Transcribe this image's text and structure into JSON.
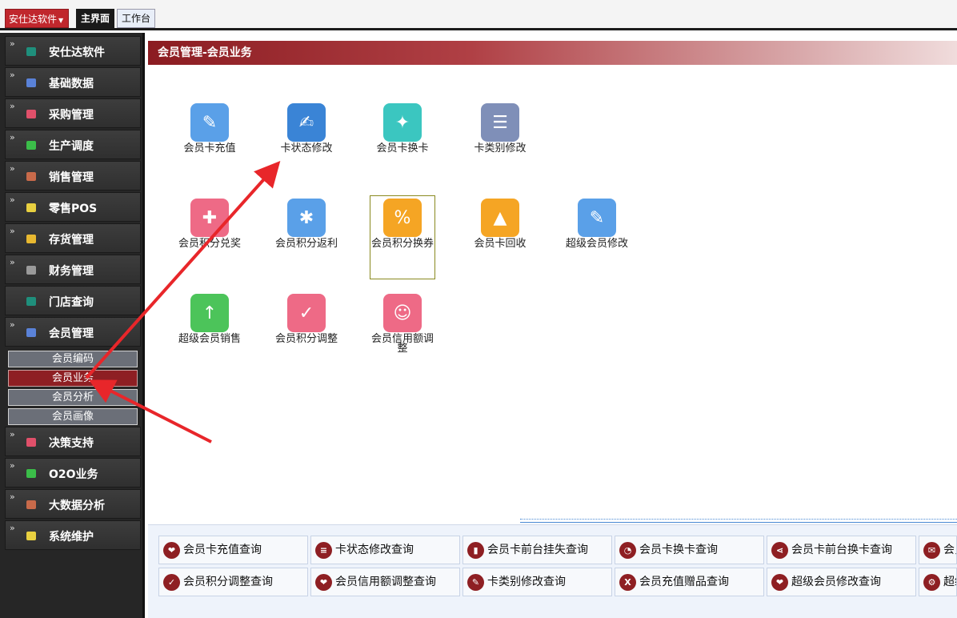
{
  "topbar": {
    "brand": "安仕达软件",
    "tabs": [
      {
        "label": "主界面"
      },
      {
        "label": "工作台"
      }
    ]
  },
  "sidebar": {
    "items": [
      {
        "label": "安仕达软件",
        "color": "#1f8f7c"
      },
      {
        "label": "基础数据",
        "color": "#5a82d8"
      },
      {
        "label": "采购管理",
        "color": "#e0506a"
      },
      {
        "label": "生产调度",
        "color": "#3bbd49"
      },
      {
        "label": "销售管理",
        "color": "#c86a4a"
      },
      {
        "label": "零售POS",
        "color": "#e8d040"
      },
      {
        "label": "存货管理",
        "color": "#e8b830"
      },
      {
        "label": "财务管理",
        "color": "#9a9a9a"
      },
      {
        "label": "门店查询",
        "color": "#1f8f7c"
      },
      {
        "label": "会员管理",
        "color": "#5a82d8"
      },
      {
        "label": "决策支持",
        "color": "#e0506a"
      },
      {
        "label": "O2O业务",
        "color": "#3bbd49"
      },
      {
        "label": "大数据分析",
        "color": "#c86a4a"
      },
      {
        "label": "系统维护",
        "color": "#e8d040"
      }
    ],
    "subitems": [
      {
        "label": "会员编码"
      },
      {
        "label": "会员业务"
      },
      {
        "label": "会员分析"
      },
      {
        "label": "会员画像"
      }
    ]
  },
  "main": {
    "title": "会员管理-会员业务",
    "tiles": [
      {
        "label": "会员卡充值",
        "color": "#5aa0e8",
        "icon": "card-recharge-icon",
        "glyph": "✎"
      },
      {
        "label": "卡状态修改",
        "color": "#3a84d6",
        "icon": "card-status-icon",
        "glyph": "✍"
      },
      {
        "label": "会员卡换卡",
        "color": "#3bc6c0",
        "icon": "card-exchange-icon",
        "glyph": "✦"
      },
      {
        "label": "卡类别修改",
        "color": "#7f8fb8",
        "icon": "card-category-icon",
        "glyph": "☰"
      },
      {
        "label": "会员积分兑奖",
        "color": "#ee6a86",
        "icon": "gift-icon",
        "glyph": "✚"
      },
      {
        "label": "会员积分返利",
        "color": "#5aa0e8",
        "icon": "rebate-icon",
        "glyph": "✱"
      },
      {
        "label": "会员积分换券",
        "color": "#f5a524",
        "icon": "coupon-icon",
        "glyph": "%"
      },
      {
        "label": "会员卡回收",
        "color": "#f5a524",
        "icon": "recycle-icon",
        "glyph": "▲"
      },
      {
        "label": "超级会员修改",
        "color": "#5aa0e8",
        "icon": "edit-icon",
        "glyph": "✎"
      },
      {
        "label": "超级会员销售",
        "color": "#4cc45a",
        "icon": "folder-upload-icon",
        "glyph": "↑"
      },
      {
        "label": "会员积分调整",
        "color": "#ee6a86",
        "icon": "adjust-icon",
        "glyph": "✓"
      },
      {
        "label": "会员信用额调整",
        "color": "#ee6a86",
        "icon": "credit-icon",
        "glyph": "☺"
      }
    ]
  },
  "reports": [
    {
      "label": "会员卡充值查询",
      "icon": "heart-icon",
      "glyph": "❤"
    },
    {
      "label": "卡状态修改查询",
      "icon": "layers-icon",
      "glyph": "≡"
    },
    {
      "label": "会员卡前台挂失查询",
      "icon": "bar-chart-icon",
      "glyph": "▮"
    },
    {
      "label": "会员卡换卡查询",
      "icon": "pie-icon",
      "glyph": "◔"
    },
    {
      "label": "会员卡前台换卡查询",
      "icon": "share-icon",
      "glyph": "⋖"
    },
    {
      "label": "会员",
      "icon": "chat-icon",
      "glyph": "✉"
    },
    {
      "label": "会员积分调整查询",
      "icon": "check-icon",
      "glyph": "✓"
    },
    {
      "label": "会员信用额调整查询",
      "icon": "heart-icon",
      "glyph": "❤"
    },
    {
      "label": "卡类别修改查询",
      "icon": "tag-icon",
      "glyph": "✎"
    },
    {
      "label": "会员充值赠品查询",
      "icon": "x-icon",
      "glyph": "X"
    },
    {
      "label": "超级会员修改查询",
      "icon": "heart-icon",
      "glyph": "❤"
    },
    {
      "label": "超级",
      "icon": "database-icon",
      "glyph": "⚙"
    }
  ]
}
